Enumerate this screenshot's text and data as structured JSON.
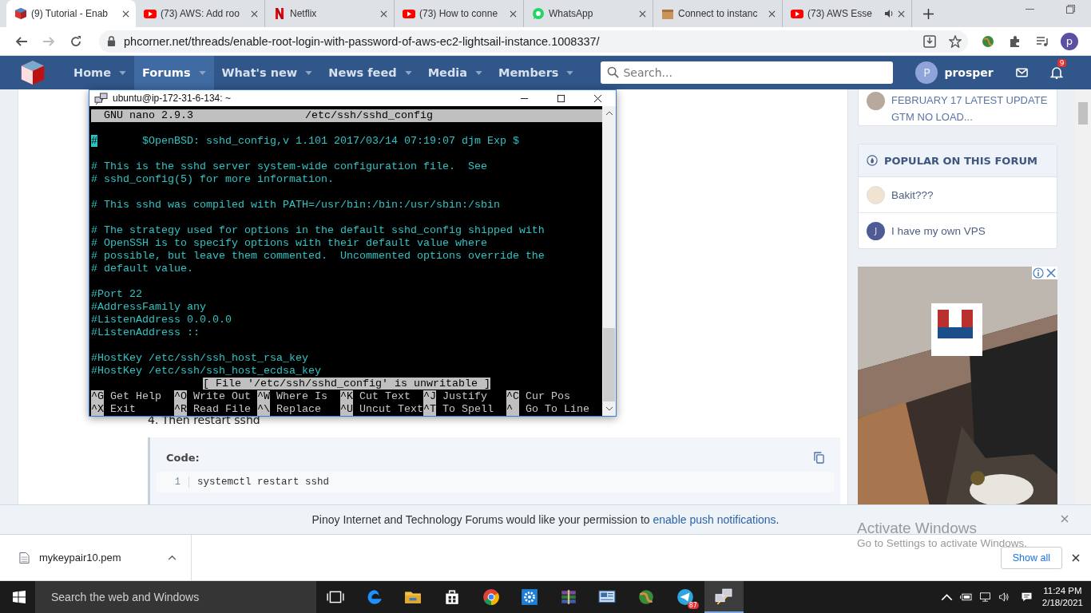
{
  "browser": {
    "tabs": [
      {
        "title": "(9) Tutorial - Enab",
        "kind": "forum",
        "selected": true,
        "audio": false
      },
      {
        "title": "(73) AWS: Add roo",
        "kind": "video",
        "selected": false,
        "audio": false
      },
      {
        "title": "Netflix",
        "kind": "film",
        "selected": false,
        "audio": false
      },
      {
        "title": "(73) How to conne",
        "kind": "video",
        "selected": false,
        "audio": false
      },
      {
        "title": "WhatsApp",
        "kind": "chat",
        "selected": false,
        "audio": false
      },
      {
        "title": "Connect to instanc",
        "kind": "package",
        "selected": false,
        "audio": false
      },
      {
        "title": "(73) AWS Esse",
        "kind": "video",
        "selected": false,
        "audio": true
      }
    ],
    "url": "phcorner.net/threads/enable-root-login-with-password-of-aws-ec2-lightsail-instance.1008337/",
    "profile": "p"
  },
  "site_nav": {
    "items": [
      {
        "label": "Home",
        "selected": false
      },
      {
        "label": "Forums",
        "selected": true
      },
      {
        "label": "What's new",
        "selected": false
      },
      {
        "label": "News feed",
        "selected": false
      },
      {
        "label": "Media",
        "selected": false
      },
      {
        "label": "Members",
        "selected": false
      }
    ],
    "search": {
      "placeholder": "Search..."
    },
    "user": {
      "initial": "P",
      "name": "prosper"
    },
    "alerts": "9"
  },
  "terminal": {
    "title": "ubuntu@ip-172-31-6-134: ~",
    "nano_version": "GNU nano 2.9.3",
    "file": "/etc/ssh/sshd_config",
    "cursor": "#",
    "blocks": [
      [
        "       $OpenBSD: sshd_config,v 1.101 2017/03/14 07:19:07 djm Exp $"
      ],
      [
        "# This is the sshd server system-wide configuration file.  See",
        "# sshd_config(5) for more information."
      ],
      [
        "# This sshd was compiled with PATH=/usr/bin:/bin:/usr/sbin:/sbin"
      ],
      [
        "# The strategy used for options in the default sshd_config shipped with",
        "# OpenSSH is to specify options with their default value where",
        "# possible, but leave them commented.  Uncommented options override the",
        "# default value."
      ],
      [
        "#Port 22",
        "#AddressFamily any",
        "#ListenAddress 0.0.0.0",
        "#ListenAddress ::"
      ],
      [
        "#HostKey /etc/ssh/ssh_host_rsa_key",
        "#HostKey /etc/ssh/ssh_host_ecdsa_key"
      ]
    ],
    "status": "[ File '/etc/ssh/sshd_config' is unwritable ]",
    "shortcuts": [
      [
        {
          "key": "^G",
          "label": "Get Help"
        },
        {
          "key": "^O",
          "label": "Write Out"
        },
        {
          "key": "^W",
          "label": "Where Is"
        },
        {
          "key": "^K",
          "label": "Cut Text"
        },
        {
          "key": "^J",
          "label": "Justify"
        },
        {
          "key": "^C",
          "label": "Cur Pos"
        }
      ],
      [
        {
          "key": "^X",
          "label": "Exit"
        },
        {
          "key": "^R",
          "label": "Read File"
        },
        {
          "key": "^\\",
          "label": "Replace"
        },
        {
          "key": "^U",
          "label": "Uncut Text"
        },
        {
          "key": "^T",
          "label": "To Spell"
        },
        {
          "key": "^",
          "label": "Go To Line"
        }
      ]
    ]
  },
  "post": {
    "step": "4. Then restart sshd",
    "code": {
      "heading": "Code:",
      "lines": [
        {
          "number": "1",
          "text": "systemctl restart sshd"
        }
      ]
    }
  },
  "sidebar": {
    "latest": {
      "title": "FEBRUARY 17 LATEST UPDATE GTM NO LOAD..."
    },
    "popular": {
      "heading": "POPULAR ON THIS FORUM",
      "items": [
        {
          "title": "Bakit???"
        },
        {
          "title": "I have my own VPS",
          "initial": "J"
        }
      ]
    }
  },
  "notification": {
    "text": "Pinoy Internet and Technology Forums would like your permission to ",
    "link": "enable push notifications",
    "end": "."
  },
  "activation": {
    "title": "Activate Windows",
    "hint": "Go to Settings to activate Windows."
  },
  "downloads": {
    "file": "mykeypair10.pem",
    "show_all": "Show all"
  },
  "taskbar": {
    "search": "Search the web and Windows",
    "apps": [
      {
        "kind": "taskview",
        "active": false
      },
      {
        "kind": "edge",
        "active": false
      },
      {
        "kind": "folder",
        "active": false
      },
      {
        "kind": "store",
        "active": false
      },
      {
        "kind": "chrome",
        "active": false
      },
      {
        "kind": "gear",
        "active": false
      },
      {
        "kind": "books",
        "active": false
      },
      {
        "kind": "panel",
        "active": false
      },
      {
        "kind": "globe",
        "active": false
      },
      {
        "kind": "telegram",
        "active": false,
        "badge": "87"
      },
      {
        "kind": "putty",
        "active": true
      }
    ],
    "time": "11:24 PM",
    "date": "2/18/2021"
  }
}
